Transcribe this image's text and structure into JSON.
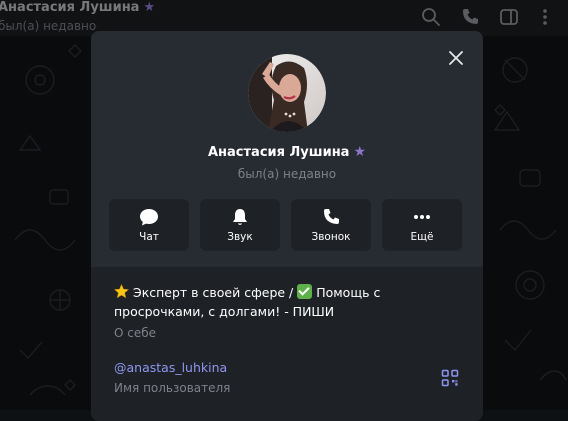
{
  "header": {
    "name": "Анастасия Лушина",
    "star_icon": "premium-star-icon",
    "status": "был(а) недавно",
    "icons": [
      "search-icon",
      "phone-icon",
      "sidebar-toggle-icon",
      "more-vertical-icon"
    ]
  },
  "profile": {
    "name": "Анастасия Лушина",
    "status": "был(а) недавно",
    "close_icon": "close-icon"
  },
  "actions": [
    {
      "label": "Чат",
      "icon": "chat-bubble-icon"
    },
    {
      "label": "Звук",
      "icon": "bell-icon"
    },
    {
      "label": "Звонок",
      "icon": "phone-icon"
    },
    {
      "label": "Ещё",
      "icon": "more-horizontal-icon"
    }
  ],
  "bio": {
    "part1": " Эксперт в своей сфере / ",
    "part2": " Помощь с просрочками, с долгами! - ПИШИ",
    "caption": "О себе"
  },
  "username": {
    "value": "@anastas_luhkina",
    "caption": "Имя пользователя"
  },
  "colors": {
    "accent_link": "#8f96f0",
    "premium_star": "#8b76c9",
    "modal_bg": "#1e2227",
    "modal_header_bg": "#272c33"
  }
}
